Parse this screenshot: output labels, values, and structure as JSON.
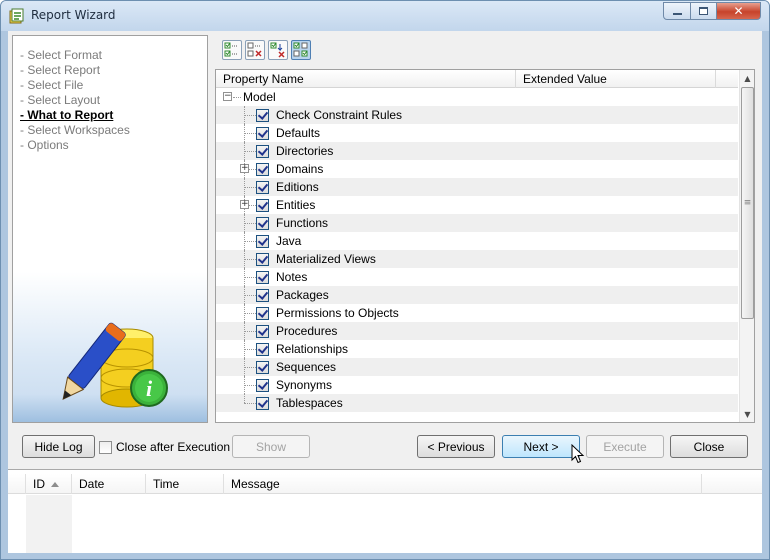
{
  "window": {
    "title": "Report Wizard",
    "controls": {
      "minimize": "minimize-icon",
      "maximize": "maximize-icon",
      "close": "close-icon"
    }
  },
  "steps": [
    {
      "label": "- Select Format",
      "active": false
    },
    {
      "label": "- Select Report",
      "active": false
    },
    {
      "label": "- Select File",
      "active": false
    },
    {
      "label": "- Select Layout",
      "active": false
    },
    {
      "label": "- What to Report",
      "active": true
    },
    {
      "label": "- Select Workspaces",
      "active": false
    },
    {
      "label": "- Options",
      "active": false
    }
  ],
  "toolbar": [
    {
      "icon": "check-all-icon"
    },
    {
      "icon": "uncheck-all-icon"
    },
    {
      "icon": "reset-checks-icon"
    },
    {
      "icon": "toggle-checks-icon",
      "pressed": true
    }
  ],
  "tree": {
    "columns": [
      "Property Name",
      "Extended Value"
    ],
    "root": "Model",
    "items": [
      {
        "label": "Check Constraint Rules",
        "checked": true,
        "expandable": false
      },
      {
        "label": "Defaults",
        "checked": true,
        "expandable": false
      },
      {
        "label": "Directories",
        "checked": true,
        "expandable": false
      },
      {
        "label": "Domains",
        "checked": true,
        "expandable": true
      },
      {
        "label": "Editions",
        "checked": true,
        "expandable": false
      },
      {
        "label": "Entities",
        "checked": true,
        "expandable": true
      },
      {
        "label": "Functions",
        "checked": true,
        "expandable": false
      },
      {
        "label": "Java",
        "checked": true,
        "expandable": false
      },
      {
        "label": "Materialized Views",
        "checked": true,
        "expandable": false
      },
      {
        "label": "Notes",
        "checked": true,
        "expandable": false
      },
      {
        "label": "Packages",
        "checked": true,
        "expandable": false
      },
      {
        "label": "Permissions to Objects",
        "checked": true,
        "expandable": false
      },
      {
        "label": "Procedures",
        "checked": true,
        "expandable": false
      },
      {
        "label": "Relationships",
        "checked": true,
        "expandable": false
      },
      {
        "label": "Sequences",
        "checked": true,
        "expandable": false
      },
      {
        "label": "Synonyms",
        "checked": true,
        "expandable": false
      },
      {
        "label": "Tablespaces",
        "checked": true,
        "expandable": false
      }
    ]
  },
  "buttons": {
    "hide_log": "Hide Log",
    "close_after_execution": "Close after Execution",
    "show": "Show",
    "previous": "< Previous",
    "next": "Next >",
    "execute": "Execute",
    "close": "Close"
  },
  "log": {
    "columns": [
      "ID",
      "Date",
      "Time",
      "Message"
    ]
  }
}
